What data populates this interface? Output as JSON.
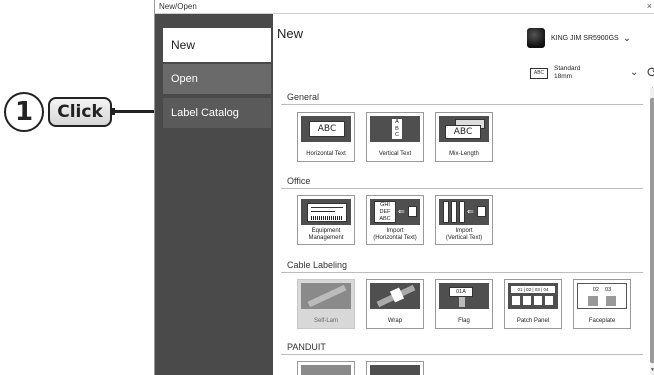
{
  "callout": {
    "number": "1",
    "label": "Click"
  },
  "window": {
    "title": "New/Open",
    "close_glyph": "×"
  },
  "sidebar": {
    "items": [
      {
        "label": "New"
      },
      {
        "label": "Open"
      },
      {
        "label": "Label Catalog"
      }
    ]
  },
  "main": {
    "title": "New"
  },
  "printer": {
    "name": "KING JIM SR5900GS",
    "caret": "⌄"
  },
  "tape": {
    "icon_text": "ABC",
    "line1": "Standard",
    "line2": "18mm",
    "caret": "⌄",
    "refresh": "⟳"
  },
  "sections": [
    {
      "name": "General",
      "tiles": [
        {
          "label": "Horizontal Text",
          "art_text": "ABC"
        },
        {
          "label": "Vertical Text",
          "art_text": "A\nB\nC"
        },
        {
          "label": "Mix-Length",
          "art_text": "ABC"
        }
      ]
    },
    {
      "name": "Office",
      "tiles": [
        {
          "label_1": "Equipment",
          "label_2": "Management"
        },
        {
          "label_1": "Import",
          "label_2": "(Horizontal Text)",
          "art_text": "GHI\nDEF\nABC"
        },
        {
          "label_1": "Import",
          "label_2": "(Vertical Text)"
        }
      ]
    },
    {
      "name": "Cable Labeling",
      "tiles": [
        {
          "label": "Self-Lam"
        },
        {
          "label": "Wrap"
        },
        {
          "label": "Flag",
          "art_text": "01A"
        },
        {
          "label": "Patch Panel",
          "art_text": "01 | 02 | 03 | 04"
        },
        {
          "label": "Faceplate",
          "art_text": "02    03"
        }
      ]
    },
    {
      "name": "PANDUIT"
    }
  ]
}
